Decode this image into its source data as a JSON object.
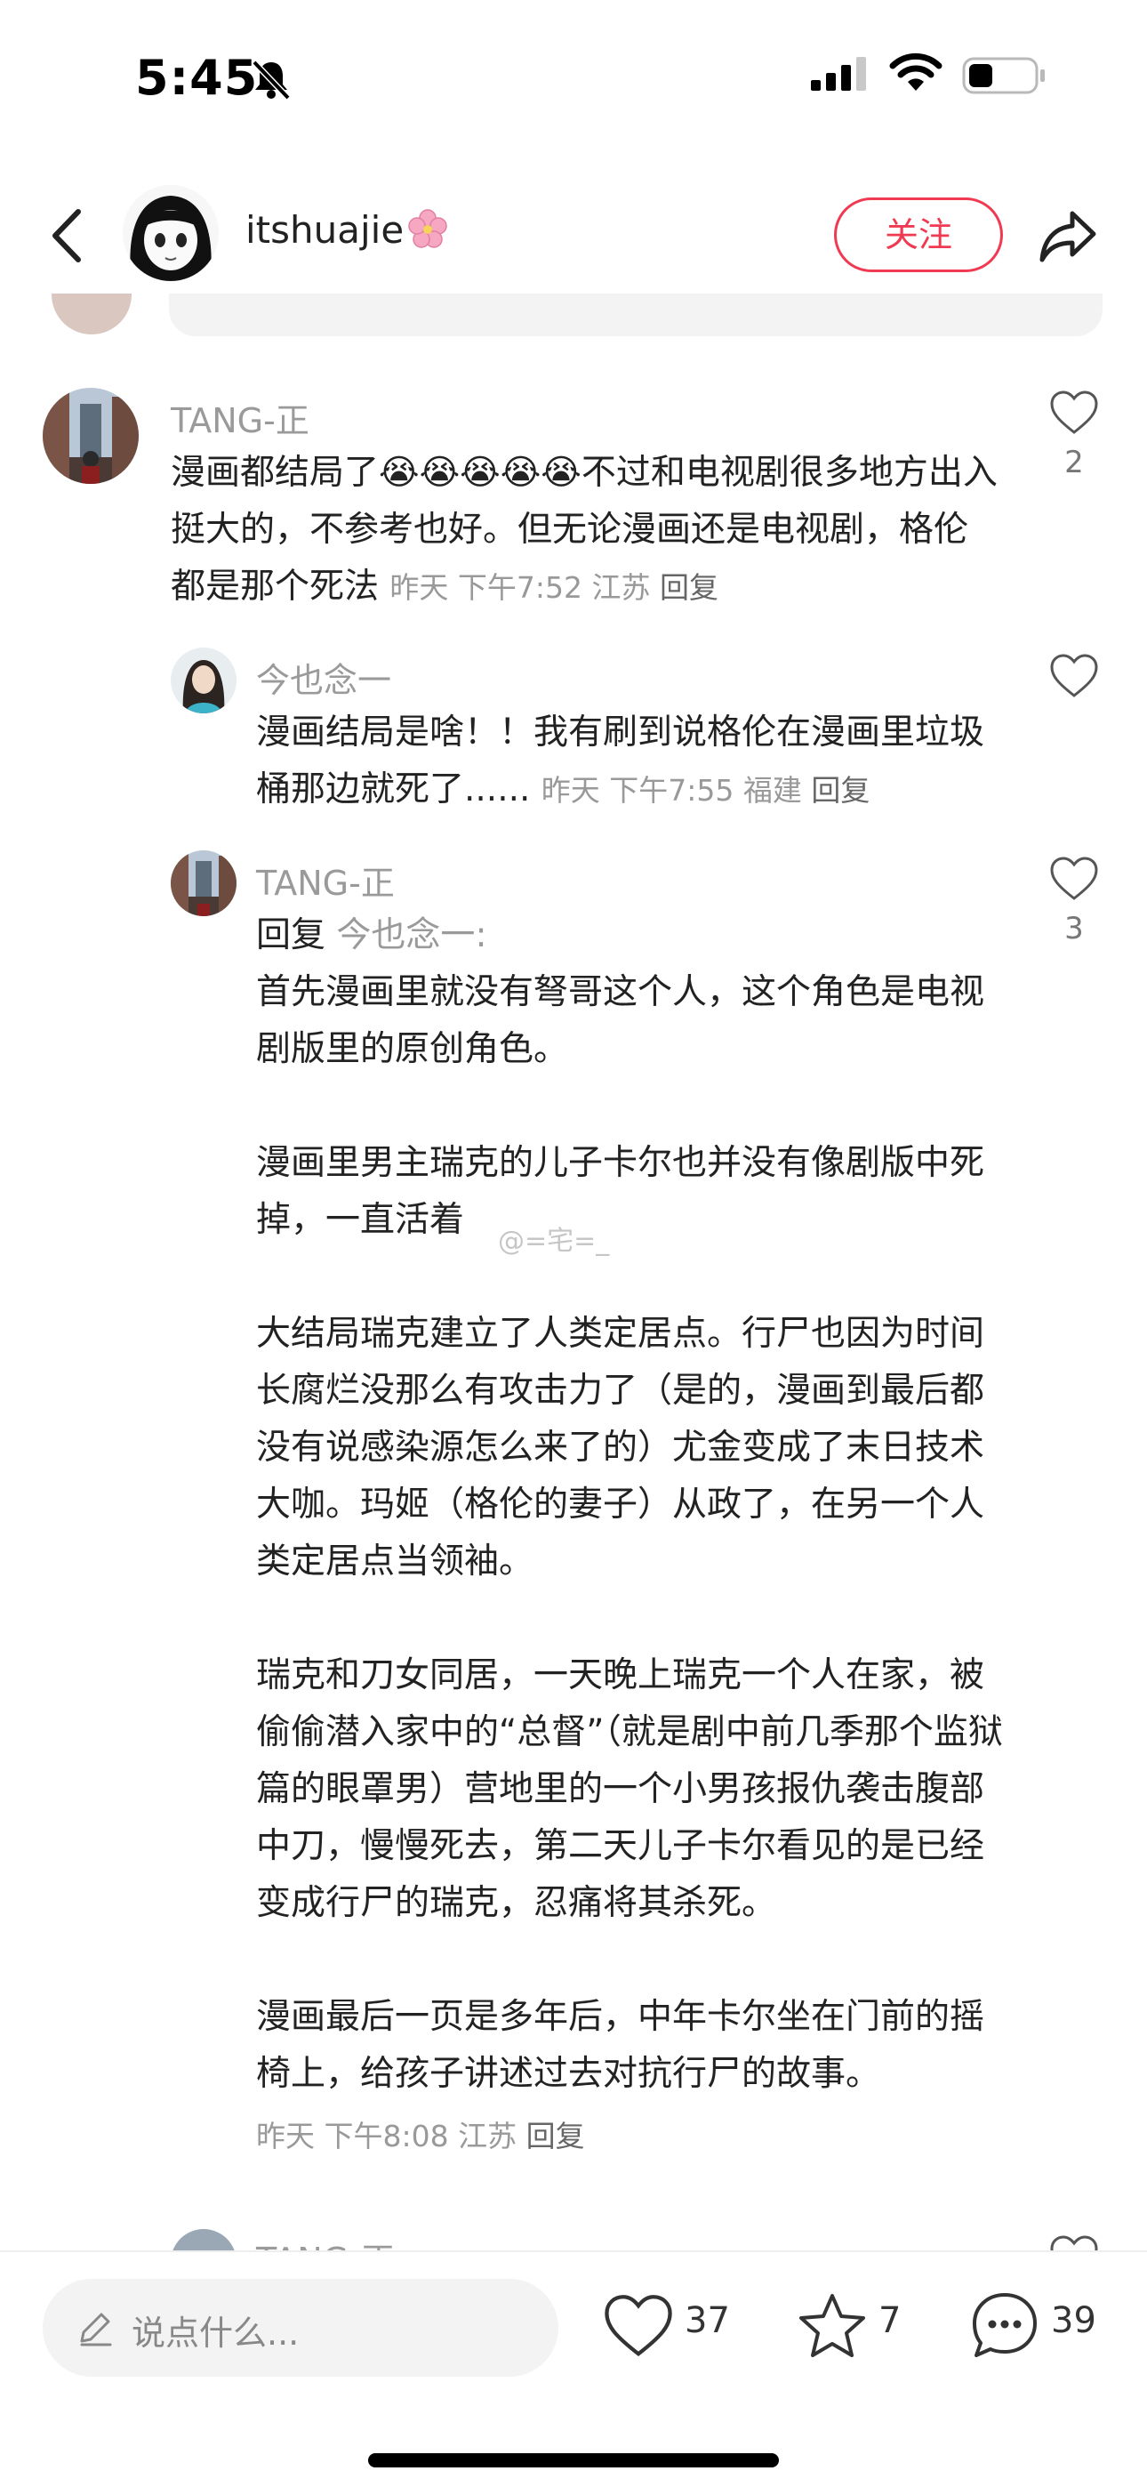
{
  "status_bar": {
    "time": "5:45"
  },
  "header": {
    "username": "itshuajie",
    "follow_label": "关注"
  },
  "comments": [
    {
      "author": "TANG-正",
      "text": "漫画都结局了😭😭😭😭😭不过和电视剧很多地方出入挺大的，不参考也好。但无论漫画还是电视剧，格伦都是那个死法",
      "meta": "昨天 下午7:52 江苏",
      "reply_label": "回复",
      "likes": "2"
    },
    {
      "author": "今也念一",
      "text": "漫画结局是啥！！我有刷到说格伦在漫画里垃圾桶那边就死了......",
      "meta": "昨天 下午7:55 福建",
      "reply_label": "回复",
      "likes": ""
    },
    {
      "author": "TANG-正",
      "reply_prefix": "回复",
      "reply_to": "今也念一",
      "paragraphs": [
        "首先漫画里就没有弩哥这个人，这个角色是电视剧版里的原创角色。",
        "漫画里男主瑞克的儿子卡尔也并没有像剧版中死掉，一直活着",
        "大结局瑞克建立了人类定居点。行尸也因为时间长腐烂没那么有攻击力了（是的，漫画到最后都没有说感染源怎么来了的）尤金变成了末日技术大咖。玛姬（格伦的妻子）从政了，在另一个人类定居点当领袖。",
        "瑞克和刀女同居，一天晚上瑞克一个人在家，被偷偷潜入家中的“总督”（就是剧中前几季那个监狱篇的眼罩男）营地里的一个小男孩报仇袭击腹部中刀，慢慢死去，第二天儿子卡尔看见的是已经变成行尸的瑞克，忍痛将其杀死。",
        "漫画最后一页是多年后，中年卡尔坐在门前的摇椅上，给孩子讲述过去对抗行尸的故事。"
      ],
      "meta": "昨天 下午8:08 江苏",
      "reply_label": "回复",
      "likes": "3"
    },
    {
      "author": "TANG-正"
    }
  ],
  "watermark": "@=宅=_",
  "bottom_bar": {
    "placeholder": "说点什么...",
    "likes": "37",
    "stars": "7",
    "comments": "39"
  },
  "colors": {
    "accent": "#f03a52",
    "muted": "#9a9a9a"
  }
}
